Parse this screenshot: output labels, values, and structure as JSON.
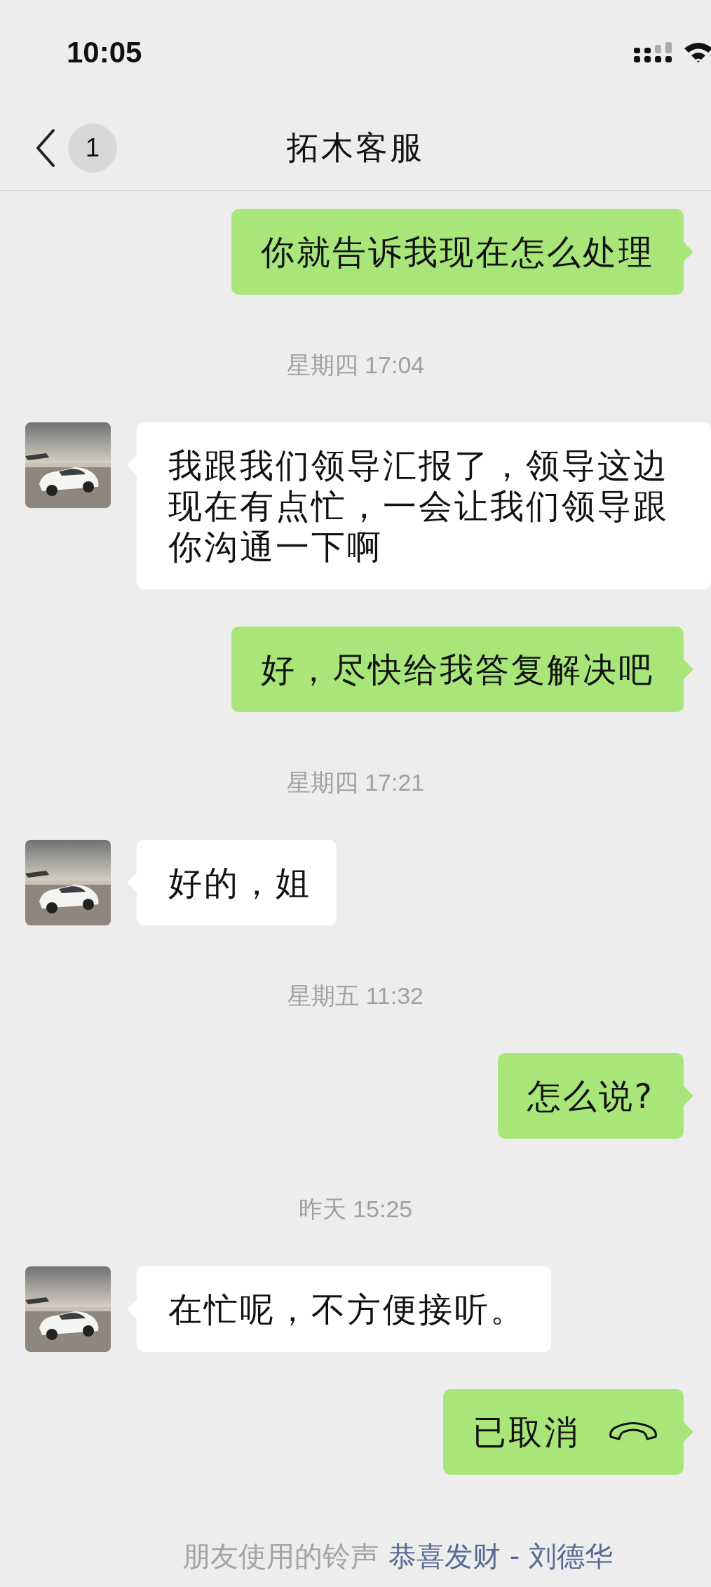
{
  "status_bar": {
    "time": "10:05"
  },
  "nav": {
    "back_badge": "1",
    "title": "拓木客服"
  },
  "messages": [
    {
      "kind": "sent",
      "text": "你就告诉我现在怎么处理"
    },
    {
      "kind": "time",
      "text": "星期四 17:04"
    },
    {
      "kind": "received",
      "text": "我跟我们领导汇报了，领导这边现在有点忙，一会让我们领导跟你沟通一下啊"
    },
    {
      "kind": "sent",
      "text": "好，尽快给我答复解决吧"
    },
    {
      "kind": "time",
      "text": "星期四 17:21"
    },
    {
      "kind": "received",
      "text": "好的，姐"
    },
    {
      "kind": "time",
      "text": "星期五 11:32"
    },
    {
      "kind": "sent",
      "text": "怎么说?"
    },
    {
      "kind": "time",
      "text": "昨天 15:25"
    },
    {
      "kind": "received",
      "text": "在忙呢，不方便接听。"
    },
    {
      "kind": "call",
      "text": "已取消"
    }
  ],
  "footer": {
    "label": "朋友使用的铃声",
    "ringtone": "恭喜发财 - 刘德华"
  }
}
